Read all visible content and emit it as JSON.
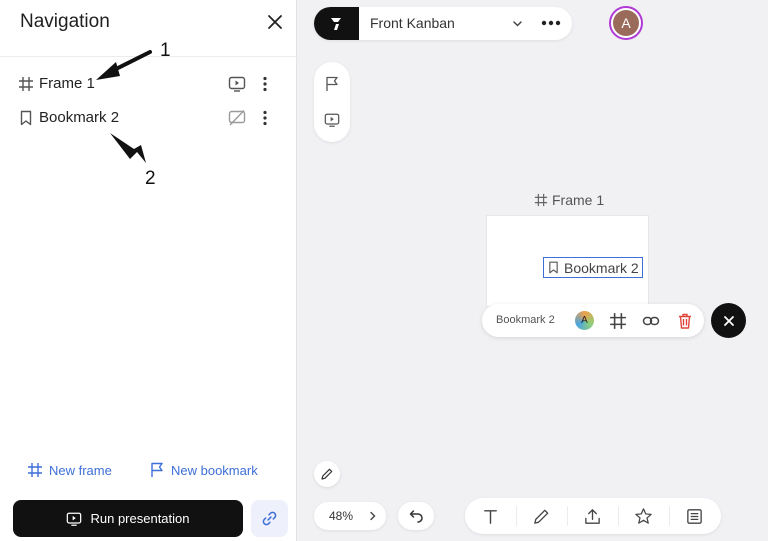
{
  "navigation": {
    "title": "Navigation",
    "items": [
      {
        "label": "Frame 1",
        "type": "frame",
        "presentation": "included"
      },
      {
        "label": "Bookmark 2",
        "type": "bookmark",
        "presentation": "excluded"
      }
    ],
    "annotations": [
      "1",
      "2"
    ],
    "new_frame_label": "New frame",
    "new_bookmark_label": "New bookmark",
    "run_label": "Run presentation"
  },
  "board": {
    "name": "Front Kanban",
    "avatar_initial": "A"
  },
  "canvas": {
    "frame_label": "Frame 1",
    "bookmark_label": "Bookmark 2"
  },
  "context_menu": {
    "label": "Bookmark 2",
    "avatar_initial": "A"
  },
  "zoom": {
    "value": "48%"
  },
  "colors": {
    "accent": "#3e6fd8",
    "avatar_ring": "#b03ad6",
    "delete": "#e0443a",
    "dark": "#111111"
  },
  "icons": [
    "close-icon",
    "frame-icon",
    "bookmark-icon",
    "present-icon",
    "present-off-icon",
    "more-vertical-icon",
    "flag-icon",
    "link-icon",
    "chevron-down-icon",
    "more-horizontal-icon",
    "pen-icon",
    "undo-icon",
    "text-icon",
    "upload-icon",
    "star-icon",
    "template-icon",
    "trash-icon"
  ]
}
